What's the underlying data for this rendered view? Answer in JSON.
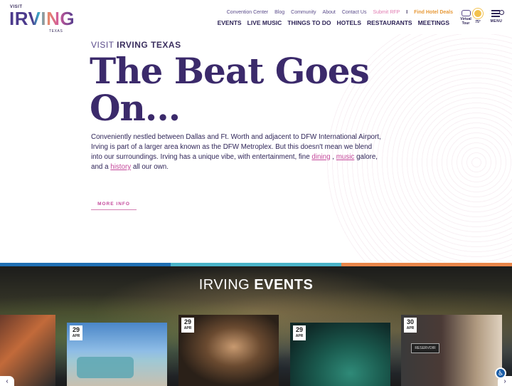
{
  "logo": {
    "visit": "VISIT",
    "name": "IRVING",
    "state": "TEXAS"
  },
  "top_nav": {
    "items": [
      "Convention Center",
      "Blog",
      "Community",
      "About",
      "Contact Us"
    ],
    "submit_rfp": "Submit RFP",
    "separator": "I",
    "hotel_deals": "Find Hotel Deals"
  },
  "main_nav": [
    "EVENTS",
    "LIVE MUSIC",
    "THINGS TO DO",
    "HOTELS",
    "RESTAURANTS",
    "MEETINGS"
  ],
  "utility": {
    "virtual_tour_label": "Virtual Tour",
    "temperature": "75°",
    "menu_label": "MENU",
    "icons": [
      "vr-headset-icon",
      "sun-icon",
      "menu-search-icon"
    ]
  },
  "hero": {
    "eyebrow_light": "VISIT ",
    "eyebrow_bold": "IRVING TEXAS",
    "headline": "The Beat Goes On...",
    "intro_text": "Conveniently nestled between Dallas and Ft. Worth and adjacent to DFW International Airport, Irving is part of a larger area known as the DFW Metroplex. But this doesn't mean we blend into our surroundings. Irving has a unique vibe, with entertainment, fine ",
    "link_dining": "dining",
    "comma": " , ",
    "link_music": "music",
    "galore": "  galore, and a ",
    "link_history": "history",
    "ending": "  all our own.",
    "more_info": "MORE INFO"
  },
  "events": {
    "title_light": "IRVING ",
    "title_bold": "EVENTS",
    "cards": [
      {
        "day": "",
        "month": ""
      },
      {
        "day": "29",
        "month": "APR"
      },
      {
        "day": "29",
        "month": "APR"
      },
      {
        "day": "29",
        "month": "APR"
      },
      {
        "day": "30",
        "month": "APR"
      }
    ],
    "sign_text": "RESERVOIR"
  },
  "colors": {
    "stripe": [
      "#1f6fb3",
      "#4ab3c8",
      "#e9864a"
    ],
    "accent": "#c4489b",
    "brand": "#3b2a6b"
  }
}
